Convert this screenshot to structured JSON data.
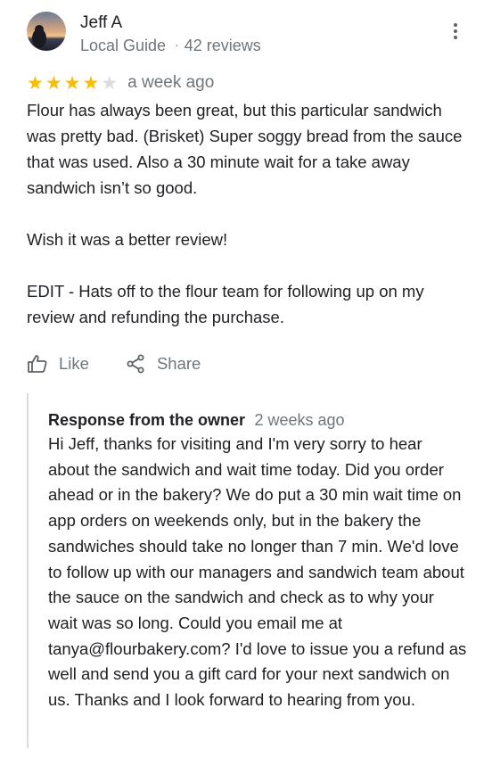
{
  "reviewer": {
    "name": "Jeff A",
    "badge": "Local Guide",
    "separator": "·",
    "review_count": "42 reviews"
  },
  "review": {
    "rating": 4,
    "rating_max": 5,
    "date": "a week ago",
    "text": "Flour has always been great, but this particular sandwich was pretty bad. (Brisket) Super soggy bread from the sauce that was used. Also a 30 minute wait for a take away sandwich isn’t so good.\n\nWish it was a better review!\n\nEDIT - Hats off to the flour team for following up on my review and refunding the purchase."
  },
  "actions": {
    "like_label": "Like",
    "share_label": "Share"
  },
  "owner_response": {
    "label": "Response from the owner",
    "date": "2 weeks ago",
    "text": "Hi Jeff, thanks for visiting and I'm very sorry to hear about the sandwich and wait time today. Did you order ahead or in the bakery? We do put a 30 min wait time on app orders on weekends only, but in the bakery the sandwiches should take no longer than 7 min. We'd love to follow up with our managers and sandwich team about the sauce on the sandwich and check as to why your wait was so long. Could you email me at tanya@flourbakery.com? I'd love to issue you a refund as well and send you a gift card for your next sandwich on us. Thanks and I look forward to hearing from you."
  },
  "icons": {
    "more": "more-vert-icon",
    "star": "star-icon",
    "like": "thumb-up-icon",
    "share": "share-icon"
  },
  "colors": {
    "star_filled": "#fbbc04",
    "star_empty": "#dadce0",
    "secondary_text": "#70757a",
    "primary_text": "#202124"
  }
}
